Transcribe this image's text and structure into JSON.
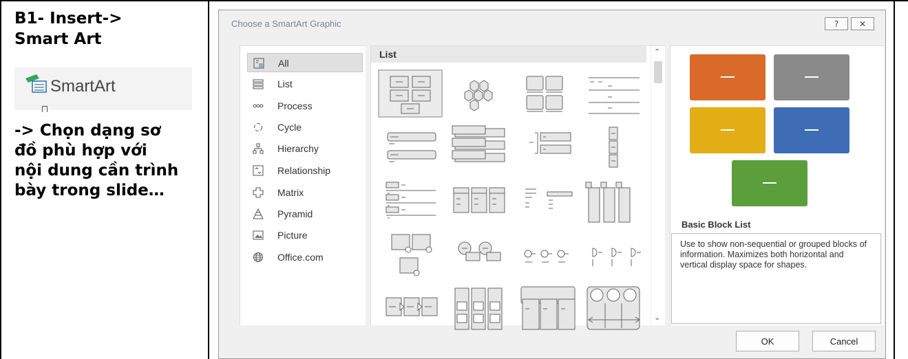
{
  "left": {
    "step_title": "B1- Insert->",
    "step_title2": "Smart Art",
    "ribbon_button": "SmartArt",
    "desc_lines": [
      "-> Chọn dạng sơ",
      "đồ phù hợp với",
      "nội dung cần trình",
      "bày trong slide…"
    ]
  },
  "dialog": {
    "title": "Choose a SmartArt Graphic",
    "help_icon": "help-icon",
    "close_icon": "close-icon",
    "categories": [
      {
        "label": "All",
        "icon": "all-icon"
      },
      {
        "label": "List",
        "icon": "list-icon"
      },
      {
        "label": "Process",
        "icon": "process-icon"
      },
      {
        "label": "Cycle",
        "icon": "cycle-icon"
      },
      {
        "label": "Hierarchy",
        "icon": "hierarchy-icon"
      },
      {
        "label": "Relationship",
        "icon": "relationship-icon"
      },
      {
        "label": "Matrix",
        "icon": "matrix-icon"
      },
      {
        "label": "Pyramid",
        "icon": "pyramid-icon"
      },
      {
        "label": "Picture",
        "icon": "picture-icon"
      },
      {
        "label": "Office.com",
        "icon": "globe-icon"
      }
    ],
    "gallery_header": "List",
    "preview": {
      "name": "Basic Block List",
      "description": "Use to show non-sequential or grouped blocks of information. Maximizes both horizontal and vertical display space for shapes.",
      "colors": {
        "orange": "#d96a2a",
        "gray": "#8a8a8a",
        "gold": "#e3ad16",
        "blue": "#3e6db5",
        "green": "#5b9e3c"
      }
    },
    "ok_label": "OK",
    "cancel_label": "Cancel"
  }
}
